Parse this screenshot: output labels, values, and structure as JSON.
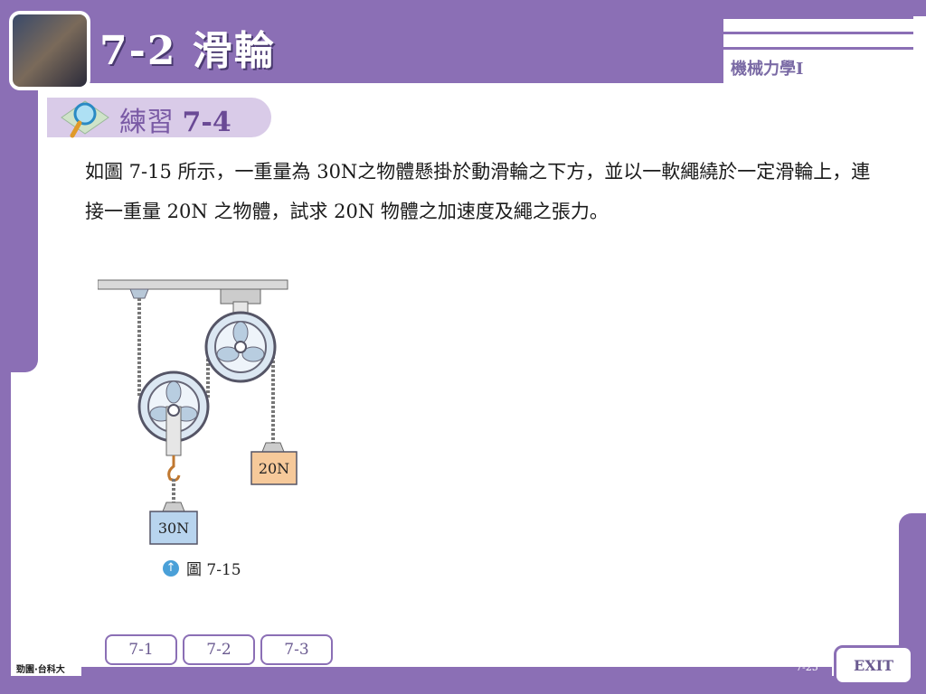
{
  "header": {
    "title": "7-2  滑輪",
    "subject": "機械力學I"
  },
  "practice": {
    "label": "練習",
    "number": "7-4"
  },
  "question": {
    "text": "如圖 7-15 所示，一重量為 30N之物體懸掛於動滑輪之下方，並以一軟繩繞於一定滑輪上，連接一重量 20N 之物體，試求 20N 物體之加速度及繩之張力。"
  },
  "figure": {
    "weight_right": "20N",
    "weight_left": "30N",
    "caption": "圖 7-15"
  },
  "nav": {
    "tabs": [
      "7-1",
      "7-2",
      "7-3"
    ]
  },
  "footer": {
    "publisher": "勁園·台科大",
    "page": "7-25",
    "exit_label": "EXIT"
  },
  "colors": {
    "accent": "#8b6fb5",
    "weight_right_fill": "#f6c99a",
    "weight_left_fill": "#b8d4ee"
  }
}
